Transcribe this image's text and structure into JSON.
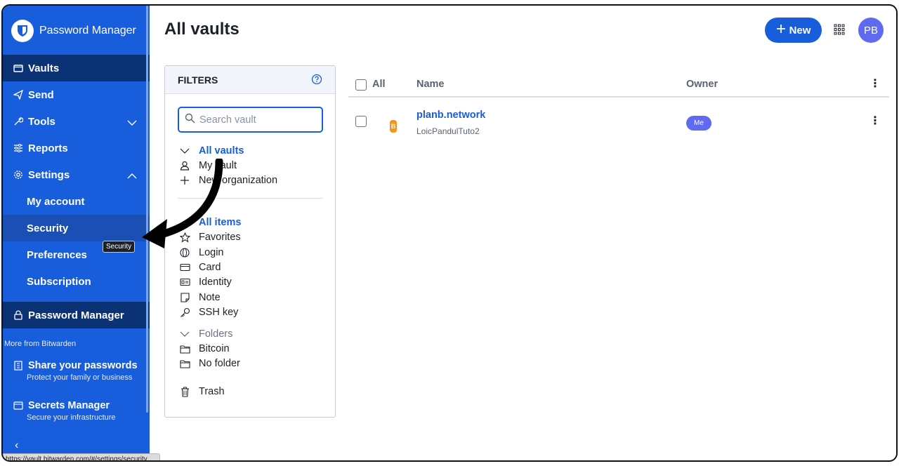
{
  "app": {
    "name": "Password Manager"
  },
  "sidebar": {
    "items": [
      {
        "label": "Vaults",
        "icon": "vault-icon"
      },
      {
        "label": "Send",
        "icon": "send-icon"
      },
      {
        "label": "Tools",
        "icon": "wrench-icon"
      },
      {
        "label": "Reports",
        "icon": "sliders-icon"
      },
      {
        "label": "Settings",
        "icon": "gear-icon"
      }
    ],
    "settings_sub": [
      {
        "label": "My account"
      },
      {
        "label": "Security"
      },
      {
        "label": "Preferences"
      },
      {
        "label": "Subscription"
      }
    ],
    "product_switch": "Password Manager",
    "more_label": "More from Bitwarden",
    "products": [
      {
        "title": "Share your passwords",
        "subtitle": "Protect your family or business"
      },
      {
        "title": "Secrets Manager",
        "subtitle": "Secure your infrastructure"
      }
    ],
    "tooltip": "Security",
    "status_url": "https://vault.bitwarden.com/#/settings/security"
  },
  "header": {
    "title": "All vaults",
    "new_button": "New",
    "avatar_initials": "PB"
  },
  "filters": {
    "title": "FILTERS",
    "search_placeholder": "Search vault",
    "vaults": [
      "All vaults",
      "My vault",
      "New organization"
    ],
    "types": [
      "All items",
      "Favorites",
      "Login",
      "Card",
      "Identity",
      "Note",
      "SSH key"
    ],
    "folders_label": "Folders",
    "folders": [
      "Bitcoin",
      "No folder"
    ],
    "trash": "Trash"
  },
  "table": {
    "headers": {
      "all": "All",
      "name": "Name",
      "owner": "Owner"
    },
    "rows": [
      {
        "name": "planb.network",
        "username": "LoicPandulTuto2",
        "owner": "Me",
        "favicon": "B"
      }
    ]
  },
  "colors": {
    "brand": "#175ddc",
    "sidebar_active": "#0c3276",
    "badge": "#5f6af0"
  }
}
